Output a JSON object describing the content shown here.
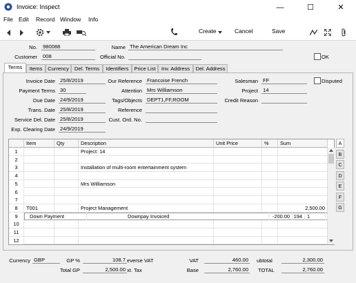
{
  "window": {
    "title": "Invoice: Inspect",
    "minimize": "—",
    "maximize": "☐",
    "close": "✕"
  },
  "menu": [
    "File",
    "Edit",
    "Record",
    "Window",
    "Info"
  ],
  "toolbar": {
    "create": "Create",
    "cancel": "Cancel",
    "save": "Save"
  },
  "header": {
    "no_label": "No.",
    "no_value": "980088",
    "name_label": "Name",
    "name_value": "The American Dream Inc",
    "customer_label": "Customer",
    "customer_value": "008",
    "official_label": "Official No.",
    "official_value": "",
    "ok_label": "OK"
  },
  "tabs": [
    "Terms",
    "Items",
    "Currency",
    "Del. Terms",
    "Identifiers",
    "Price List",
    "Inv. Address",
    "Del. Address"
  ],
  "terms": {
    "invoice_date_label": "Invoice Date",
    "invoice_date": "25/8/2019",
    "payment_terms_label": "Payment Terms",
    "payment_terms": "30",
    "due_date_label": "Due Date",
    "due_date": "24/9/2019",
    "trans_date_label": "Trans. Date",
    "trans_date": "25/8/2019",
    "service_del_label": "Service Del. Date",
    "service_del": "25/8/2019",
    "exp_clearing_label": "Exp. Clearing Date",
    "exp_clearing": "24/9/2019",
    "our_ref_label": "Our Reference",
    "our_ref": "Francoise French",
    "attention_label": "Attention",
    "attention": "Mrs Williamson",
    "tags_label": "Tags/Objects",
    "tags": "DEPT1,FF,ROOM",
    "reference_label": "Reference",
    "reference": "",
    "cust_ord_label": "Cust. Ord. No.",
    "cust_ord": "",
    "salesman_label": "Salesman",
    "salesman": "FF",
    "project_label": "Project",
    "project": "14",
    "credit_reason_label": "Credit Reason",
    "credit_reason": "",
    "disputed_label": "Disputed"
  },
  "grid": {
    "headers": [
      "Item",
      "Qty",
      "Description",
      "Unit Price",
      "%",
      "Sum"
    ],
    "rows": [
      {
        "n": "1",
        "item": "",
        "qty": "",
        "desc": "Project: 14",
        "price": "",
        "pct": "",
        "sum": ""
      },
      {
        "n": "2",
        "item": "",
        "qty": "",
        "desc": "",
        "price": "",
        "pct": "",
        "sum": ""
      },
      {
        "n": "3",
        "item": "",
        "qty": "",
        "desc": "Installation of multi-room entertainment system",
        "price": "",
        "pct": "",
        "sum": ""
      },
      {
        "n": "4",
        "item": "",
        "qty": "",
        "desc": "",
        "price": "",
        "pct": "",
        "sum": ""
      },
      {
        "n": "5",
        "item": "",
        "qty": "",
        "desc": "Mrs Williamson",
        "price": "",
        "pct": "",
        "sum": ""
      },
      {
        "n": "6",
        "item": "",
        "qty": "",
        "desc": "",
        "price": "",
        "pct": "",
        "sum": ""
      },
      {
        "n": "7",
        "item": "",
        "qty": "",
        "desc": "",
        "price": "",
        "pct": "",
        "sum": ""
      },
      {
        "n": "8",
        "item": "T001",
        "qty": "",
        "desc": "Project Management",
        "price": "",
        "pct": "",
        "sum": "2,500.00"
      },
      {
        "n": "9",
        "item": "",
        "qty": "",
        "desc": "",
        "price": "",
        "pct": "",
        "sum": ""
      },
      {
        "n": "10",
        "item": "",
        "qty": "",
        "desc": "",
        "price": "",
        "pct": "",
        "sum": ""
      },
      {
        "n": "11",
        "item": "",
        "qty": "",
        "desc": "",
        "price": "",
        "pct": "",
        "sum": ""
      },
      {
        "n": "12",
        "item": "",
        "qty": "",
        "desc": "",
        "price": "",
        "pct": "",
        "sum": ""
      }
    ],
    "row9_overlay": {
      "a": "Down Payment",
      "b": "Downpay Invoiced",
      "c": "-200.00",
      "d": "194",
      "e": "1"
    },
    "field_tabs": [
      "A",
      "B",
      "C",
      "D",
      "E",
      "F",
      "G"
    ]
  },
  "footer": {
    "currency_label": "Currency",
    "currency": "GBP",
    "gp_pct_label": "GP %",
    "gp_pct": "108.7",
    "reverse_vat_label": "everse VAT",
    "reverse_vat": "",
    "vat_label": "VAT",
    "vat": "460.00",
    "subtotal_label": "ubtotal",
    "subtotal": "2,300.00",
    "total_gp_label": "Total GP",
    "total_gp": "2,500.00",
    "ext_tax_label": "xt. Tax",
    "ext_tax": "",
    "base_label": "Base",
    "base": "2,760.00",
    "total_label": "TOTAL",
    "total": "2,760.00"
  }
}
